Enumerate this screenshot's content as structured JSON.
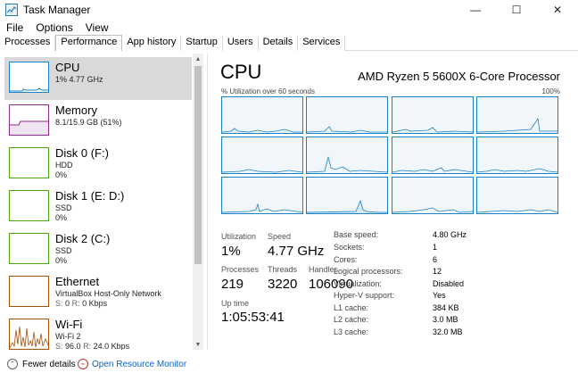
{
  "window": {
    "title": "Task Manager",
    "buttons": {
      "minimize": "—",
      "maximize": "☐",
      "close": "✕"
    }
  },
  "menu": [
    "File",
    "Options",
    "View"
  ],
  "tabs": [
    "Processes",
    "Performance",
    "App history",
    "Startup",
    "Users",
    "Details",
    "Services"
  ],
  "left_items": [
    {
      "name": "CPU",
      "line1": "1%  4.77 GHz",
      "line2": "",
      "color": "#1981c6"
    },
    {
      "name": "Memory",
      "line1": "8.1/15.9 GB (51%)",
      "line2": "",
      "color": "#8b2a8b"
    },
    {
      "name": "Disk 0 (F:)",
      "line1": "HDD",
      "line2": "0%",
      "color": "#4da60c"
    },
    {
      "name": "Disk 1 (E: D:)",
      "line1": "SSD",
      "line2": "0%",
      "color": "#4da60c"
    },
    {
      "name": "Disk 2 (C:)",
      "line1": "SSD",
      "line2": "0%",
      "color": "#4da60c"
    },
    {
      "name": "Ethernet",
      "line1": "VirtualBox Host-Only Network",
      "line2_label_s": "S:",
      "line2_val_s": "0",
      "line2_label_r": "R:",
      "line2_val_r": "0 Kbps",
      "color": "#a74f01"
    },
    {
      "name": "Wi-Fi",
      "line1": "Wi-Fi 2",
      "line2_label_s": "S:",
      "line2_val_s": "96.0",
      "line2_label_r": "R:",
      "line2_val_r": "24.0 Kbps",
      "color": "#a74f01"
    }
  ],
  "cpu": {
    "title": "CPU",
    "model": "AMD Ryzen 5 5600X 6-Core Processor",
    "graph_label": "% Utilization over 60 seconds",
    "graph_max": "100%",
    "stats": {
      "utilization_label": "Utilization",
      "utilization": "1%",
      "speed_label": "Speed",
      "speed": "4.77 GHz",
      "processes_label": "Processes",
      "processes": "219",
      "threads_label": "Threads",
      "threads": "3220",
      "handles_label": "Handles",
      "handles": "106090",
      "uptime_label": "Up time",
      "uptime": "1:05:53:41"
    },
    "specs": [
      {
        "k": "Base speed:",
        "v": "4.80 GHz"
      },
      {
        "k": "Sockets:",
        "v": "1"
      },
      {
        "k": "Cores:",
        "v": "6"
      },
      {
        "k": "Logical processors:",
        "v": "12"
      },
      {
        "k": "Virtualization:",
        "v": "Disabled"
      },
      {
        "k": "Hyper-V support:",
        "v": "Yes"
      },
      {
        "k": "L1 cache:",
        "v": "384 KB"
      },
      {
        "k": "L2 cache:",
        "v": "3.0 MB"
      },
      {
        "k": "L3 cache:",
        "v": "32.0 MB"
      }
    ]
  },
  "footer": {
    "fewer_details": "Fewer details",
    "open_resmon": "Open Resource Monitor"
  },
  "colors": {
    "cpu_line": "#1981c6",
    "cpu_fill": "#d7e8f5",
    "memory": "#8b2a8b",
    "disk": "#4da60c",
    "network": "#a74f01",
    "link": "#0a63c8",
    "selected": "#d9d9d9"
  }
}
